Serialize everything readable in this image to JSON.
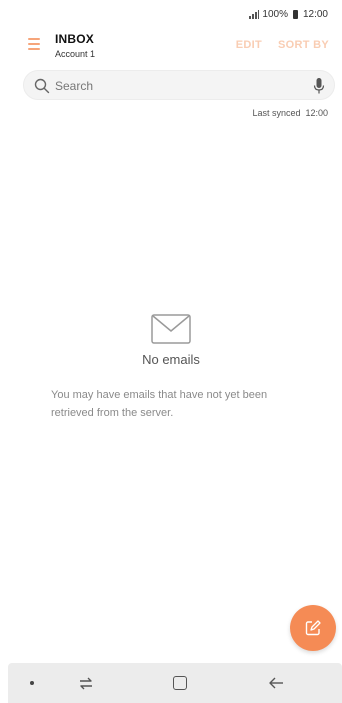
{
  "status_bar": {
    "battery": "100%",
    "time": "12:00"
  },
  "header": {
    "title": "INBOX",
    "account": "Account 1",
    "edit_label": "EDIT",
    "sort_label": "SORT BY"
  },
  "search": {
    "placeholder": "Search"
  },
  "sync": {
    "label": "Last synced",
    "time": "12:00"
  },
  "empty_state": {
    "title": "No emails",
    "message": "You may have emails that have not yet been retrieved from the server."
  },
  "colors": {
    "accent": "#f58b55",
    "accent_light": "#f9cdb3",
    "nav_bar": "#ececec"
  },
  "icons": [
    "menu-icon",
    "search-icon",
    "mic-icon",
    "envelope-icon",
    "compose-icon",
    "recent-apps-icon",
    "home-icon",
    "back-icon"
  ]
}
